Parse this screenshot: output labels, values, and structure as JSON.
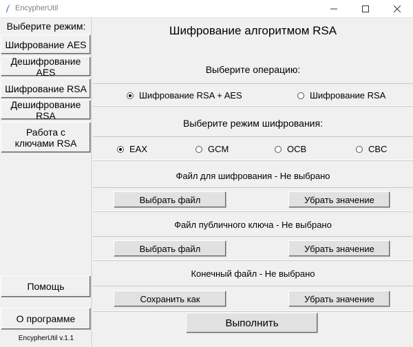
{
  "window": {
    "title": "EncypherUtil"
  },
  "sidebar": {
    "title": "Выберите режим:",
    "items": [
      {
        "label": "Шифрование AES"
      },
      {
        "label": "Дешифрование AES"
      },
      {
        "label": "Шифрование RSA"
      },
      {
        "label": "Дешифрование RSA"
      },
      {
        "label": "Работа с\nключами RSA"
      }
    ],
    "help_label": "Помощь",
    "about_label": "О программе",
    "version": "EncypherUtil v.1.1"
  },
  "main": {
    "title": "Шифрование алгоритмом RSA",
    "operation_prompt": "Выберите операцию:",
    "operations": [
      {
        "label": "Шифрование RSA + AES",
        "selected": true
      },
      {
        "label": "Шифрование RSA",
        "selected": false
      }
    ],
    "mode_prompt": "Выберите режим шифрования:",
    "modes": [
      {
        "label": "EAX",
        "selected": true
      },
      {
        "label": "GCM",
        "selected": false
      },
      {
        "label": "OCB",
        "selected": false
      },
      {
        "label": "CBC",
        "selected": false
      }
    ],
    "input_file_label": "Файл для шифрования - Не выбрано",
    "public_key_label": "Файл публичного ключа - Не выбрано",
    "output_file_label": "Конечный файл - Не выбрано",
    "choose_file_label": "Выбрать файл",
    "choose_key_label": "Выбрать файл",
    "save_as_label": "Сохранить как",
    "clear_label_1": "Убрать значение",
    "clear_label_2": "Убрать значение",
    "clear_label_3": "Убрать значение",
    "run_label": "Выполнить"
  },
  "colors": {
    "background": "#f0f0f0",
    "button_face": "#e1e1e1"
  }
}
